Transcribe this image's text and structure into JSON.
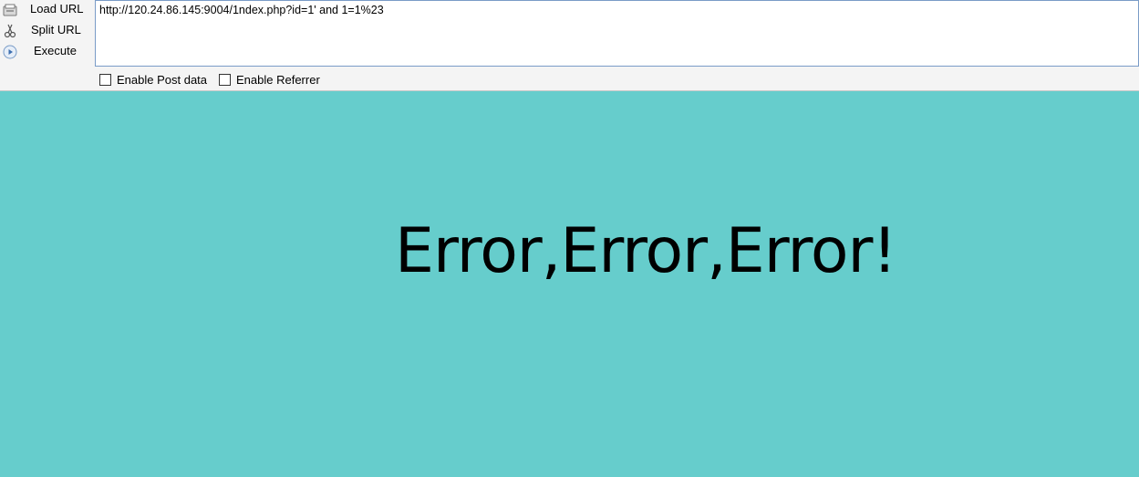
{
  "toolbar": {
    "load_url": "Load URL",
    "split_url": "Split URL",
    "execute": "Execute",
    "url_value": "http://120.24.86.145:9004/1ndex.php?id=1' and 1=1%23",
    "enable_post": "Enable Post data",
    "enable_referrer": "Enable Referrer"
  },
  "content": {
    "message": "Error,Error,Error!",
    "background_color": "#66cdcc"
  }
}
